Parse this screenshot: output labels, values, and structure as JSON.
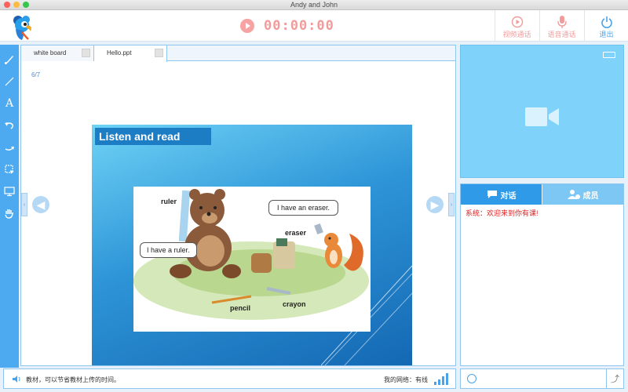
{
  "window": {
    "title": "Andy and John"
  },
  "header": {
    "timer": "00:00:00",
    "buttons": {
      "video_call": "视频通话",
      "voice_call": "语音通话",
      "exit": "退出"
    }
  },
  "tabs": [
    {
      "label": "white board"
    },
    {
      "label": "Hello.ppt"
    }
  ],
  "page_indicator": "6/7",
  "slide": {
    "title": "Listen and read",
    "labels": {
      "ruler": "ruler",
      "eraser": "eraser",
      "pencil": "pencil",
      "crayon": "crayon"
    },
    "bubbles": {
      "ruler_line": "I have a ruler.",
      "eraser_line": "I have an eraser."
    }
  },
  "chat": {
    "tab_chat": "对话",
    "tab_members": "成员",
    "messages": [
      "系统：欢迎来到你有课!"
    ]
  },
  "status": {
    "text": "教材，可以节省教材上传的时间。",
    "network": "我的网络：有线"
  },
  "icons": {
    "logo": "parrot-logo",
    "record": "record-icon",
    "video": "video-camera-icon",
    "mic": "microphone-icon",
    "power": "power-icon"
  },
  "colors": {
    "accent_blue": "#4eaaf0",
    "call_red": "#f29b9b",
    "system_message": "#e02020"
  }
}
